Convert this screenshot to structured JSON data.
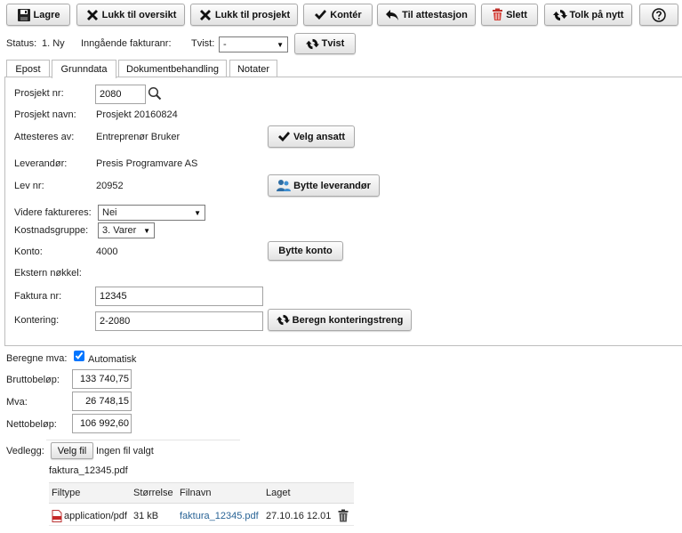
{
  "toolbar": {
    "save": "Lagre",
    "close_overview": "Lukk til oversikt",
    "close_project": "Lukk til prosjekt",
    "post": "Kontér",
    "to_attest": "Til attestasjon",
    "delete": "Slett",
    "reinterpret": "Tolk på nytt",
    "help_icon": "help-icon"
  },
  "statusbar": {
    "status_label": "Status:",
    "status_value": "1. Ny",
    "incoming_label": "Inngående fakturanr:",
    "dispute_label": "Tvist:",
    "dispute_value": "-",
    "dispute_button": "Tvist"
  },
  "tabs": [
    "Epost",
    "Grunndata",
    "Dokumentbehandling",
    "Notater"
  ],
  "form": {
    "project_no_label": "Prosjekt nr:",
    "project_no_value": "2080",
    "project_name_label": "Prosjekt navn:",
    "project_name_value": "Prosjekt 20160824",
    "attest_label": "Attesteres av:",
    "attest_value": "Entreprenør Bruker",
    "select_employee_button": "Velg ansatt",
    "supplier_label": "Leverandør:",
    "supplier_value": "Presis Programvare AS",
    "supplier_no_label": "Lev nr:",
    "supplier_no_value": "20952",
    "change_supplier_button": "Bytte leverandør",
    "reinvoice_label": "Videre faktureres:",
    "reinvoice_value": "Nei",
    "cost_group_label": "Kostnadsgruppe:",
    "cost_group_value": "3. Varer",
    "account_label": "Konto:",
    "account_value": "4000",
    "change_account_button": "Bytte konto",
    "external_key_label": "Ekstern nøkkel:",
    "invoice_no_label": "Faktura nr:",
    "invoice_no_value": "12345",
    "posting_label": "Kontering:",
    "posting_value": "2-2080",
    "calc_posting_button": "Beregn konteringstreng"
  },
  "amounts": {
    "calc_vat_label": "Beregne mva:",
    "automatic_label": "Automatisk",
    "automatic_checked": true,
    "gross_label": "Bruttobeløp:",
    "gross_value": "133 740,75",
    "vat_label": "Mva:",
    "vat_value": "26 748,15",
    "net_label": "Nettobeløp:",
    "net_value": "106 992,60"
  },
  "attachments": {
    "label": "Vedlegg:",
    "choose_file_button": "Velg fil",
    "no_file_text": "Ingen fil valgt",
    "current_file": "faktura_12345.pdf",
    "columns": [
      "Filtype",
      "Størrelse",
      "Filnavn",
      "Laget"
    ],
    "rows": [
      {
        "type": "application/pdf",
        "size": "31 kB",
        "name": "faktura_12345.pdf",
        "created": "27.10.16 12.01"
      }
    ]
  }
}
